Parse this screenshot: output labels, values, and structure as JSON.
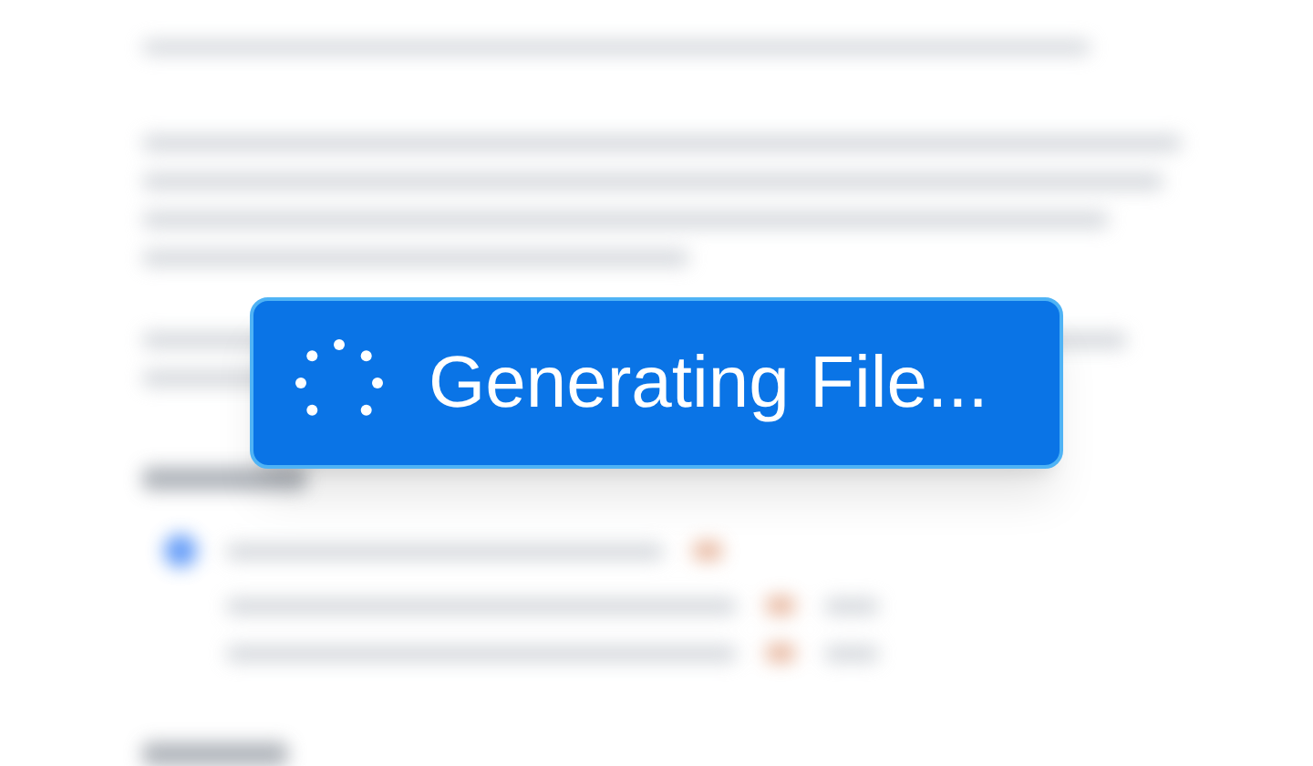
{
  "status_button": {
    "label": "Generating File..."
  }
}
